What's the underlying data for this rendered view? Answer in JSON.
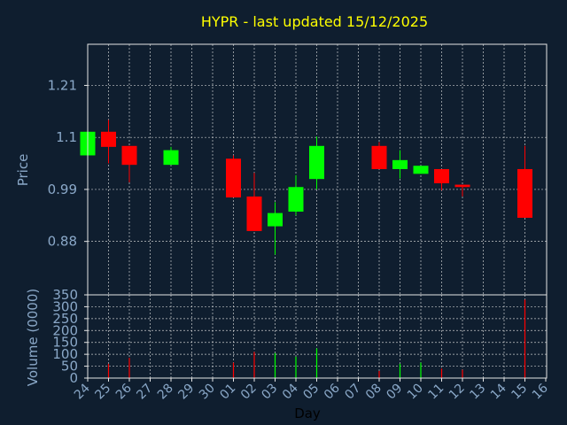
{
  "title": "HYPR - last updated 15/12/2025",
  "colors": {
    "background": "#0f1e2f",
    "title": "#ffff00",
    "axis_text": "#8aa8c8",
    "frame": "#e6e6e6",
    "grid": "#e6e6e6",
    "up": "#00ff00",
    "down": "#ff0000"
  },
  "chart_data": [
    {
      "type": "candlestick",
      "ylabel": "Price",
      "xlabel": "",
      "ylim": [
        0.767,
        1.297
      ],
      "yticks": [
        "1.21",
        "1.1",
        "0.99",
        "0.88"
      ],
      "ytick_values": [
        1.21,
        1.1,
        0.99,
        0.88
      ],
      "grid": true,
      "candles": [
        {
          "x": 0,
          "open": 1.062,
          "close": 1.112,
          "high": 1.112,
          "low": 1.062
        },
        {
          "x": 1,
          "open": 1.112,
          "close": 1.08,
          "high": 1.137,
          "low": 1.045
        },
        {
          "x": 2,
          "open": 1.082,
          "close": 1.042,
          "high": 1.082,
          "low": 1.005
        },
        {
          "x": 4,
          "open": 1.042,
          "close": 1.073,
          "high": 1.08,
          "low": 1.042
        },
        {
          "x": 7,
          "open": 1.055,
          "close": 0.973,
          "high": 1.062,
          "low": 0.973
        },
        {
          "x": 8,
          "open": 0.975,
          "close": 0.902,
          "high": 1.025,
          "low": 0.902
        },
        {
          "x": 9,
          "open": 0.912,
          "close": 0.94,
          "high": 0.963,
          "low": 0.852
        },
        {
          "x": 10,
          "open": 0.943,
          "close": 0.995,
          "high": 1.02,
          "low": 0.935
        },
        {
          "x": 11,
          "open": 1.012,
          "close": 1.082,
          "high": 1.102,
          "low": 0.99
        },
        {
          "x": 14,
          "open": 1.082,
          "close": 1.033,
          "high": 1.09,
          "low": 1.033
        },
        {
          "x": 15,
          "open": 1.033,
          "close": 1.052,
          "high": 1.073,
          "low": 1.013
        },
        {
          "x": 16,
          "open": 1.023,
          "close": 1.04,
          "high": 1.04,
          "low": 1.023
        },
        {
          "x": 17,
          "open": 1.033,
          "close": 1.003,
          "high": 1.033,
          "low": 0.988
        },
        {
          "x": 18,
          "open": 1.0,
          "close": 0.995,
          "high": 1.0,
          "low": 0.975
        },
        {
          "x": 21,
          "open": 1.033,
          "close": 0.93,
          "high": 1.082,
          "low": 0.93
        }
      ]
    },
    {
      "type": "bar",
      "ylabel": "Volume (0000)",
      "xlabel": "Day",
      "ylim": [
        0,
        350
      ],
      "yticks": [
        "350",
        "300",
        "250",
        "200",
        "150",
        "100",
        "50",
        "0"
      ],
      "ytick_values": [
        350,
        300,
        250,
        200,
        150,
        100,
        50,
        0
      ],
      "grid": true,
      "categories": [
        "24",
        "25",
        "26",
        "27",
        "28",
        "29",
        "30",
        "01",
        "02",
        "03",
        "04",
        "05",
        "06",
        "07",
        "08",
        "09",
        "10",
        "11",
        "12",
        "13",
        "14",
        "15",
        "16"
      ],
      "bars": [
        {
          "x": 1,
          "value": 60,
          "dir": "down"
        },
        {
          "x": 2,
          "value": 85,
          "dir": "down"
        },
        {
          "x": 7,
          "value": 65,
          "dir": "down"
        },
        {
          "x": 8,
          "value": 110,
          "dir": "down"
        },
        {
          "x": 9,
          "value": 105,
          "dir": "up"
        },
        {
          "x": 10,
          "value": 90,
          "dir": "up"
        },
        {
          "x": 11,
          "value": 125,
          "dir": "up"
        },
        {
          "x": 14,
          "value": 30,
          "dir": "down"
        },
        {
          "x": 15,
          "value": 60,
          "dir": "up"
        },
        {
          "x": 16,
          "value": 65,
          "dir": "up"
        },
        {
          "x": 17,
          "value": 40,
          "dir": "down"
        },
        {
          "x": 18,
          "value": 35,
          "dir": "down"
        },
        {
          "x": 21,
          "value": 330,
          "dir": "down"
        }
      ]
    }
  ]
}
